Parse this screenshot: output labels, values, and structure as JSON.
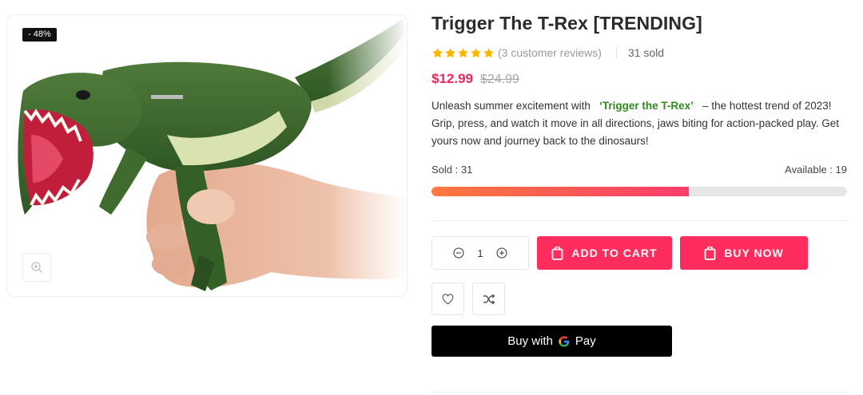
{
  "gallery": {
    "badge": "- 48%",
    "zoom_icon": "zoom-in-icon"
  },
  "product": {
    "title": "Trigger The T-Rex [TRENDING]",
    "rating": 5,
    "reviews_text": "(3 customer reviews)",
    "sold_text": "31 sold",
    "price_current": "$12.99",
    "price_old": "$24.99",
    "description": {
      "before": "Unleash summer excitement with",
      "highlight": "‘Trigger the T-Rex’",
      "after": "– the hottest trend of 2023! Grip, press, and watch it move in all directions, jaws biting for action-packed play. Get yours now and journey back to the dinosaurs!"
    }
  },
  "stock": {
    "sold_label": "Sold : 31",
    "available_label": "Available : 19",
    "sold_fraction": 0.62
  },
  "purchase": {
    "quantity": "1",
    "add_to_cart_label": "ADD TO CART",
    "buy_now_label": "BUY NOW",
    "gpay_label": "Buy with",
    "gpay_brand": "Pay"
  },
  "colors": {
    "accent": "#ff2d5e",
    "price": "#f0245d",
    "highlight": "#2f8a1f",
    "star": "#ffb400",
    "progress_start": "#ff7a3c",
    "progress_end": "#ff3d6d"
  },
  "icons": {
    "star": "star-icon",
    "minus": "minus-circle-icon",
    "plus": "plus-circle-icon",
    "bag": "shopping-bag-icon",
    "heart": "heart-icon",
    "shuffle": "shuffle-icon",
    "google": "google-g-icon"
  }
}
